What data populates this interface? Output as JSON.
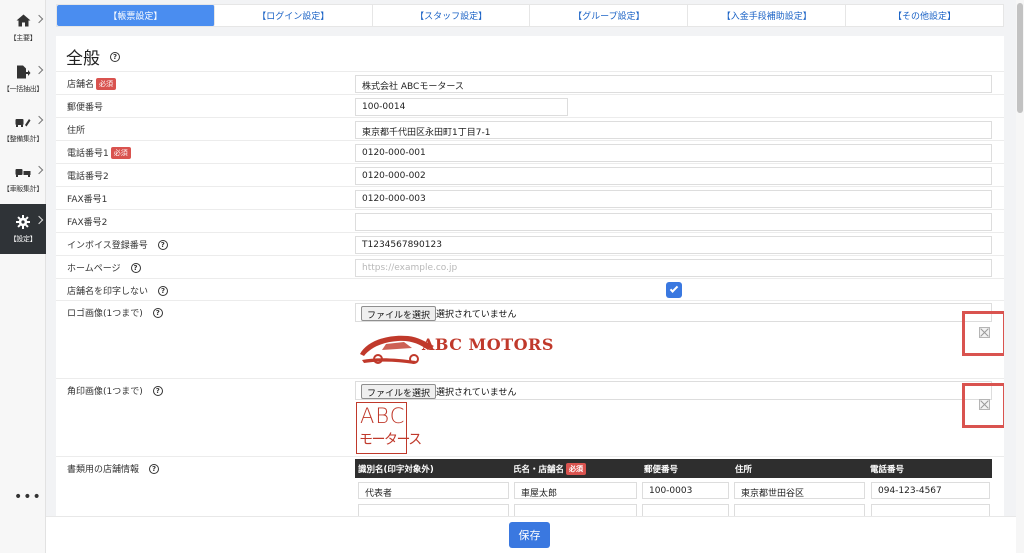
{
  "sidebar": {
    "items": [
      {
        "label": "【主要】",
        "icon": "home-icon"
      },
      {
        "label": "【一括抽出】",
        "icon": "file-export-icon"
      },
      {
        "label": "【整備集計】",
        "icon": "car-wrench-icon"
      },
      {
        "label": "【車販集計】",
        "icon": "car-bed-icon"
      },
      {
        "label": "【設定】",
        "icon": "gear-icon"
      }
    ],
    "more_label": "•••"
  },
  "tabs": [
    {
      "label": "【帳票設定】",
      "active": true
    },
    {
      "label": "【ログイン設定】"
    },
    {
      "label": "【スタッフ設定】"
    },
    {
      "label": "【グループ設定】"
    },
    {
      "label": "【入金手段補助設定】"
    },
    {
      "label": "【その他設定】"
    }
  ],
  "section": {
    "title": "全般",
    "help": "?"
  },
  "required_badge": "必須",
  "fields": {
    "store_name": {
      "label": "店舗名",
      "value": "株式会社 ABCモータース"
    },
    "postal": {
      "label": "郵便番号",
      "value": "100-0014"
    },
    "address": {
      "label": "住所",
      "value": "東京都千代田区永田町1丁目7-1"
    },
    "phone1": {
      "label": "電話番号1",
      "value": "0120-000-001"
    },
    "phone2": {
      "label": "電話番号2",
      "value": "0120-000-002"
    },
    "fax1": {
      "label": "FAX番号1",
      "value": "0120-000-003"
    },
    "fax2": {
      "label": "FAX番号2",
      "value": ""
    },
    "invoice": {
      "label": "インボイス登録番号",
      "value": "T1234567890123"
    },
    "homepage": {
      "label": "ホームページ",
      "value": "",
      "placeholder": "https://example.co.jp"
    },
    "hide_store_name": {
      "label": "店舗名を印字しない",
      "checked": true
    },
    "logo": {
      "label": "ロゴ画像(1つまで)",
      "button": "ファイルを選択",
      "status": "選択されていません",
      "logo_text": "ABC MOTORS"
    },
    "seal": {
      "label": "角印画像(1つまで)",
      "button": "ファイルを選択",
      "status": "選択されていません",
      "seal_line1": "ABC",
      "seal_line2": "モータース"
    },
    "store_info": {
      "label": "書類用の店舗情報"
    }
  },
  "store_table": {
    "headers": [
      "識別名(印字対象外)",
      "氏名・店舗名",
      "郵便番号",
      "住所",
      "電話番号"
    ],
    "rows": [
      [
        "代表者",
        "車屋太郎",
        "100-0003",
        "東京都世田谷区",
        "094-123-4567"
      ]
    ]
  },
  "footer": {
    "save_label": "保存"
  },
  "colors": {
    "accent": "#3a78e0",
    "required": "#d9534f",
    "highlight_frame": "#d9534f"
  }
}
